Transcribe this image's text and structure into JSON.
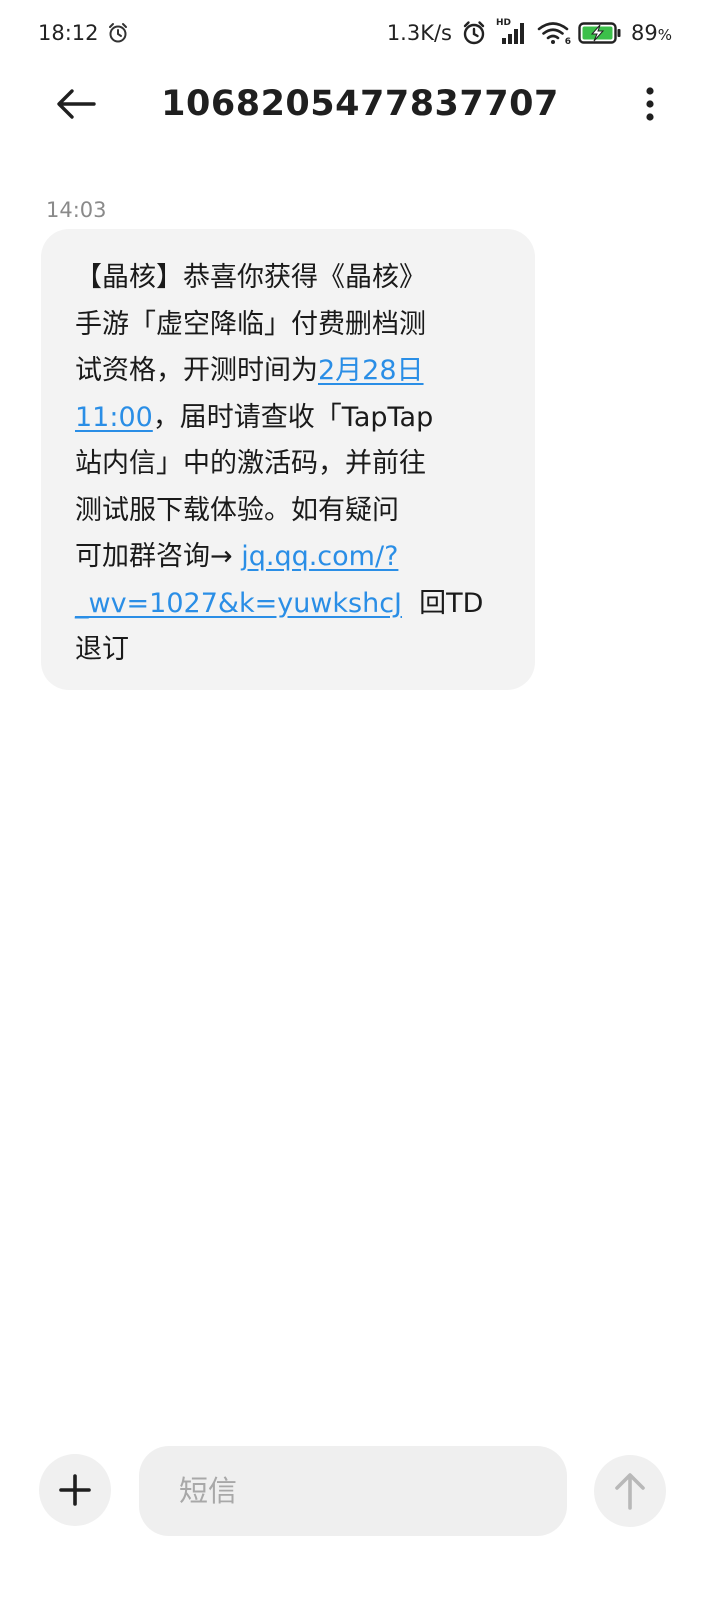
{
  "status_bar": {
    "time": "18:12",
    "network_speed": "1.3K/s",
    "network_type": "HD",
    "wifi_label": "6",
    "battery": "89",
    "battery_unit": "%",
    "icons": [
      "alarm-icon",
      "alarm-icon",
      "signal-icon",
      "wifi-icon",
      "battery-charging-icon"
    ]
  },
  "header": {
    "title": "1068205477837707",
    "back_icon": "back-arrow-icon",
    "more_icon": "more-vertical-icon"
  },
  "conversation": {
    "timestamp": "14:03",
    "message": {
      "l1": "【晶核】恭喜你获得《晶核》",
      "l2": "手游「虚空降临」付费删档测",
      "l3_pre": "试资格，开测时间为",
      "date_link_a": "2月28日",
      "date_link_b": "11:00",
      "l4_post": "，届时请查收「TapTap",
      "l5": "站内信」中的激活码，并前往",
      "l6": "测试服下载体验。如有疑问",
      "l7_pre": "可加群咨询→ ",
      "url_link_a": "jq.qq.com/?",
      "url_link_b": "_wv=1027&k=yuwkshcJ",
      "l8_post": "  回TD",
      "l9": "退订"
    }
  },
  "composer": {
    "placeholder": "短信",
    "value": "",
    "add_icon": "plus-icon",
    "send_icon": "send-arrow-icon"
  },
  "colors": {
    "link": "#2a8ee6",
    "bubble": "#f3f3f3",
    "battery_fill": "#3cc04a"
  }
}
